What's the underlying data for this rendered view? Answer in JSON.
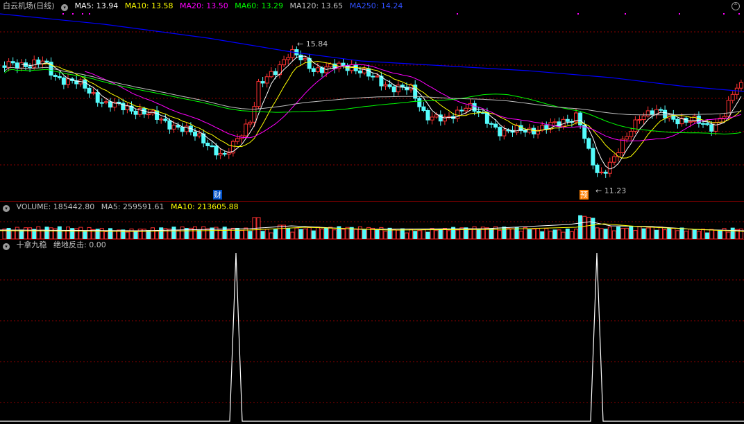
{
  "stock": {
    "title": "白云机场(日线)",
    "ma_items": [
      {
        "label": "MA5: 13.94",
        "color": "#ffffff"
      },
      {
        "label": "MA10: 13.58",
        "color": "#ffff00"
      },
      {
        "label": "MA20: 13.50",
        "color": "#ff00ff"
      },
      {
        "label": "MA60: 13.29",
        "color": "#00ff00"
      },
      {
        "label": "MA120: 13.65",
        "color": "#c0c0c0"
      },
      {
        "label": "MA250: 14.24",
        "color": "#0000ff"
      }
    ],
    "high_label": "15.84",
    "low_label": "11.23",
    "markers": [
      "财",
      "预"
    ]
  },
  "volume": {
    "title": "VOLUME: 185442.80",
    "ma5": "MA5: 259591.61",
    "ma10": "MA10: 213605.88"
  },
  "indicator": {
    "title": "十拿九稳",
    "value": "绝地反击: 0.00"
  },
  "colors": {
    "up": "#ff3232",
    "down": "#54fcfc",
    "grid": "#8b0000",
    "ma5": "#ffffff",
    "ma10": "#ffff00",
    "ma20": "#ff00ff",
    "ma60": "#00ff00",
    "ma120": "#c0c0c0",
    "ma250": "#0000ff"
  }
}
